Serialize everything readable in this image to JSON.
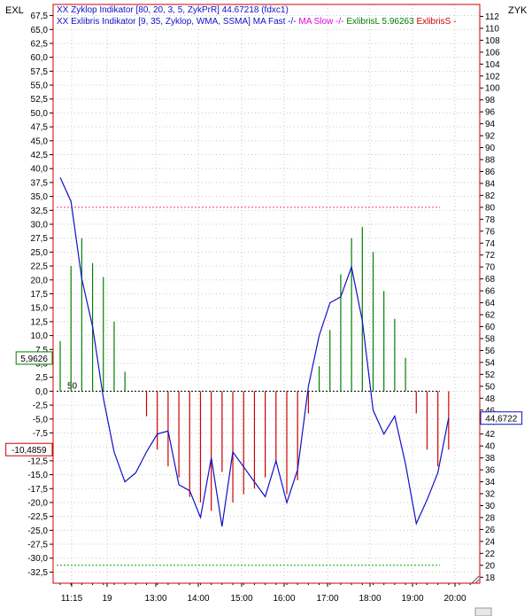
{
  "corner_left": "EXL",
  "corner_right": "ZYK",
  "legend": {
    "line1": "XX Zyklop Indikator [80, 20, 3, 5, ZykPrR] 44.67218 (fdxc1)",
    "line2_blue": "XX Exlibris Indikator [9, 35, Zyklop, WMA, SSMA] MA Fast -/-",
    "line2_magenta": "MA Slow -/-",
    "line2_green": "ExlibrisL 5.96263",
    "line2_red": "ExlibrisS -"
  },
  "colors": {
    "frame": "#cc0000",
    "zyklop": "#1010c8",
    "exlibris_long": "#008000",
    "exlibris_short": "#cc0000",
    "upper_level": "#ff3399",
    "lower_level": "#00aa00",
    "ma_slow": "#e000e0",
    "grid": "#c8c8c8"
  },
  "chart_data": {
    "type": "line",
    "x_tick_labels": [
      "11:15",
      "19",
      "13:00",
      "14:00",
      "15:00",
      "16:00",
      "17:00",
      "18:00",
      "19:00",
      "20:00"
    ],
    "left_axis": {
      "name": "EXL",
      "range": [
        -34.5,
        69.5
      ],
      "step": 2.5,
      "tick_labels": [
        "67,5",
        "65,0",
        "62,5",
        "60,0",
        "57,5",
        "55,0",
        "52,5",
        "50,0",
        "47,5",
        "45,0",
        "42,5",
        "40,0",
        "37,5",
        "35,0",
        "32,5",
        "30,0",
        "27,5",
        "25,0",
        "22,5",
        "20,0",
        "17,5",
        "15,0",
        "12,5",
        "10,0",
        "7,5",
        "5,0",
        "2,5",
        "0,0",
        "-2,5",
        "-5,0",
        "-7,5",
        "-10,0",
        "-12,5",
        "-15,0",
        "-17,5",
        "-20,0",
        "-22,5",
        "-25,0",
        "-27,5",
        "-30,0",
        "-32,5"
      ]
    },
    "right_axis": {
      "name": "ZYK",
      "range": [
        17,
        114
      ],
      "step": 2,
      "tick_labels": [
        "112",
        "110",
        "108",
        "106",
        "104",
        "102",
        "100",
        "98",
        "96",
        "94",
        "92",
        "90",
        "88",
        "86",
        "84",
        "82",
        "80",
        "78",
        "76",
        "74",
        "72",
        "70",
        "68",
        "66",
        "64",
        "62",
        "60",
        "58",
        "56",
        "54",
        "52",
        "50",
        "48",
        "46",
        "44",
        "42",
        "40",
        "38",
        "36",
        "34",
        "32",
        "30",
        "28",
        "26",
        "24",
        "22",
        "20",
        "18"
      ]
    },
    "zero_line_label": "50",
    "badges": [
      {
        "axis": "left",
        "value": 5.9626,
        "label": "5,9626",
        "color": "#008000"
      },
      {
        "axis": "left",
        "value": -10.4859,
        "label": "-10,4859",
        "color": "#cc0000"
      },
      {
        "axis": "right",
        "value": 44.6722,
        "label": "44,6722",
        "color": "#1010c8"
      }
    ],
    "levels": [
      {
        "axis": "right",
        "value": 80,
        "color": "#ff3399"
      },
      {
        "axis": "right",
        "value": 20,
        "color": "#00aa00"
      }
    ],
    "series": [
      {
        "name": "XX Zyklop Indikator",
        "axis": "right",
        "color": "#1010c8",
        "values": [
          85,
          81,
          68,
          60,
          48,
          39,
          34,
          35.5,
          39,
          42,
          42.5,
          33.5,
          32.5,
          28,
          38,
          26.5,
          39,
          36.5,
          34,
          31.5,
          37.5,
          30.5,
          36,
          50,
          58.5,
          64,
          65,
          70,
          61,
          46,
          42,
          45,
          37,
          27,
          31,
          35.5,
          44.7
        ]
      },
      {
        "name": "ExlibrisL",
        "axis": "left",
        "color": "#008000",
        "values": [
          9,
          22.5,
          27.5,
          23,
          20.5,
          12.5,
          3.5,
          0,
          0,
          0,
          0,
          0,
          0,
          0,
          0,
          0,
          0,
          0,
          0,
          0,
          0,
          0,
          0,
          0,
          4.5,
          11,
          21,
          27.5,
          29.5,
          25,
          18,
          13,
          6,
          0,
          0,
          0,
          0
        ]
      },
      {
        "name": "ExlibrisS",
        "axis": "left",
        "color": "#cc0000",
        "values": [
          0,
          0,
          0,
          0,
          0,
          0,
          0,
          0,
          -4.5,
          -10.5,
          -13.5,
          -15.5,
          -19,
          -20,
          -21.5,
          -14.5,
          -20,
          -18.5,
          -17.5,
          -15.5,
          -13,
          -18.5,
          -16,
          -4,
          0,
          0,
          0,
          0,
          0,
          0,
          0,
          0,
          0,
          -4,
          -10.5,
          -13.5,
          -10.5
        ]
      }
    ]
  }
}
